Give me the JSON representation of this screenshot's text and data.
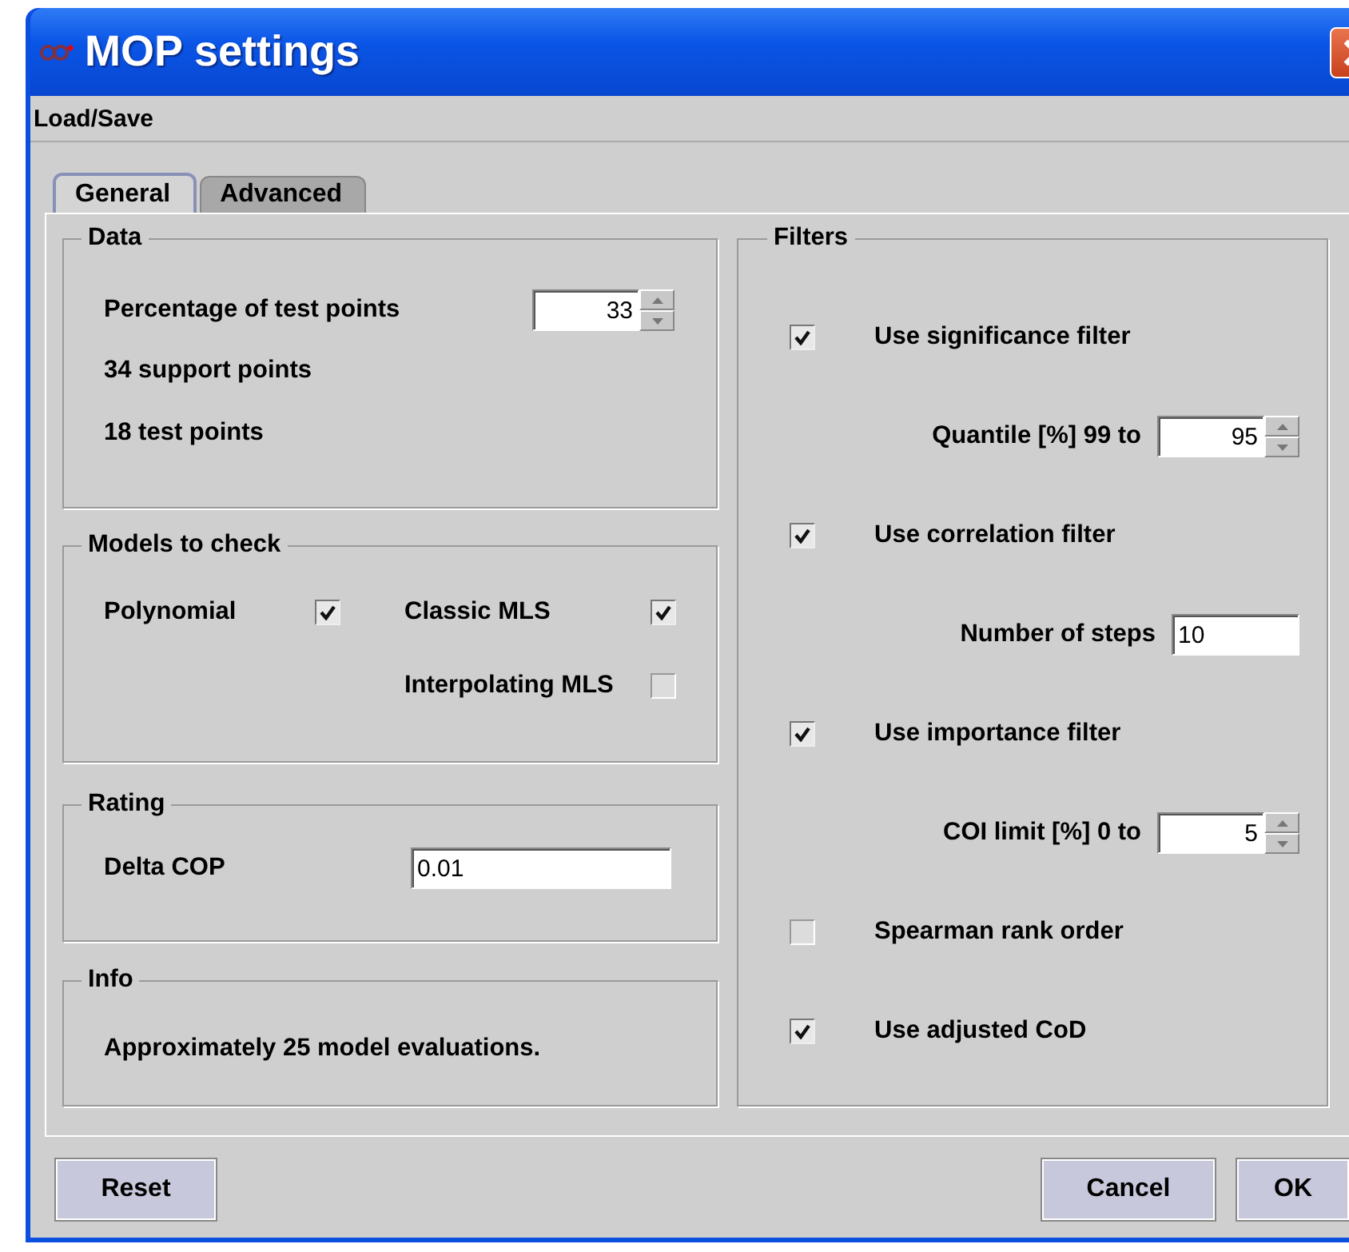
{
  "window": {
    "title": "MOP settings"
  },
  "menu": [
    "Load/Save"
  ],
  "tabs": [
    {
      "label": "General",
      "selected": true
    },
    {
      "label": "Advanced",
      "selected": false
    }
  ],
  "data": {
    "title": "Data",
    "percentage_label": "Percentage of test points",
    "percentage_value": "33",
    "support_points": "34 support points",
    "test_points": "18 test points"
  },
  "models": {
    "title": "Models to check",
    "items": [
      {
        "label": "Polynomial",
        "checked": true
      },
      {
        "label": "Classic MLS",
        "checked": true
      },
      {
        "label": "Interpolating MLS",
        "checked": false
      }
    ]
  },
  "rating": {
    "title": "Rating",
    "label": "Delta COP",
    "value": "0.01"
  },
  "info": {
    "title": "Info",
    "text": "Approximately 25 model evaluations."
  },
  "filters": {
    "title": "Filters",
    "rows": [
      {
        "kind": "checkbox",
        "label": "Use significance filter",
        "checked": true
      },
      {
        "kind": "spinner",
        "label": "Quantile [%] 99 to",
        "value": "95"
      },
      {
        "kind": "checkbox",
        "label": "Use correlation filter",
        "checked": true
      },
      {
        "kind": "field",
        "label": "Number of steps",
        "value": "10"
      },
      {
        "kind": "checkbox",
        "label": "Use importance filter",
        "checked": true
      },
      {
        "kind": "spinner",
        "label": "COI limit [%] 0 to",
        "value": "5"
      },
      {
        "kind": "checkbox",
        "label": "Spearman rank order",
        "checked": false
      },
      {
        "kind": "checkbox",
        "label": "Use adjusted CoD",
        "checked": true
      }
    ]
  },
  "buttons": {
    "left": [
      "Reset"
    ],
    "right": [
      "Cancel",
      "OK"
    ]
  }
}
